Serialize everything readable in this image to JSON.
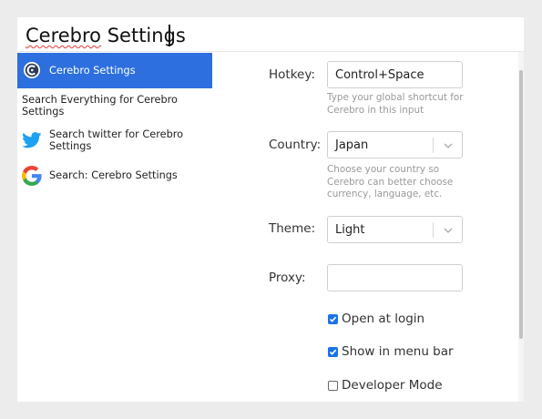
{
  "search": {
    "query": "Cerebro Settings",
    "query_misspelled_word": "Cerebro",
    "query_rest": " Settings"
  },
  "results": [
    {
      "label": "Cerebro Settings",
      "icon": "cerebro-logo-icon",
      "selected": true
    },
    {
      "label": "Search Everything for Cerebro Settings",
      "icon": null,
      "selected": false
    },
    {
      "label": "Search twitter for Cerebro Settings",
      "icon": "twitter-bird-icon",
      "selected": false
    },
    {
      "label": "Search: Cerebro Settings",
      "icon": "google-g-icon",
      "selected": false
    }
  ],
  "settings": {
    "hotkey": {
      "label": "Hotkey:",
      "value": "Control+Space",
      "hint": "Type your global shortcut for Cerebro in this input"
    },
    "country": {
      "label": "Country:",
      "value": "Japan",
      "hint": "Choose your country so Cerebro can better choose currency, language, etc."
    },
    "theme": {
      "label": "Theme:",
      "value": "Light"
    },
    "proxy": {
      "label": "Proxy:",
      "value": ""
    },
    "open_at_login": {
      "label": "Open at login",
      "checked": true
    },
    "show_in_menu_bar": {
      "label": "Show in menu bar",
      "checked": true
    },
    "developer_mode": {
      "label": "Developer Mode",
      "checked": false
    }
  },
  "colors": {
    "accent": "#2d6fde",
    "checkbox": "#1a73e8",
    "hint": "#999999",
    "twitter": "#1da1f2"
  }
}
